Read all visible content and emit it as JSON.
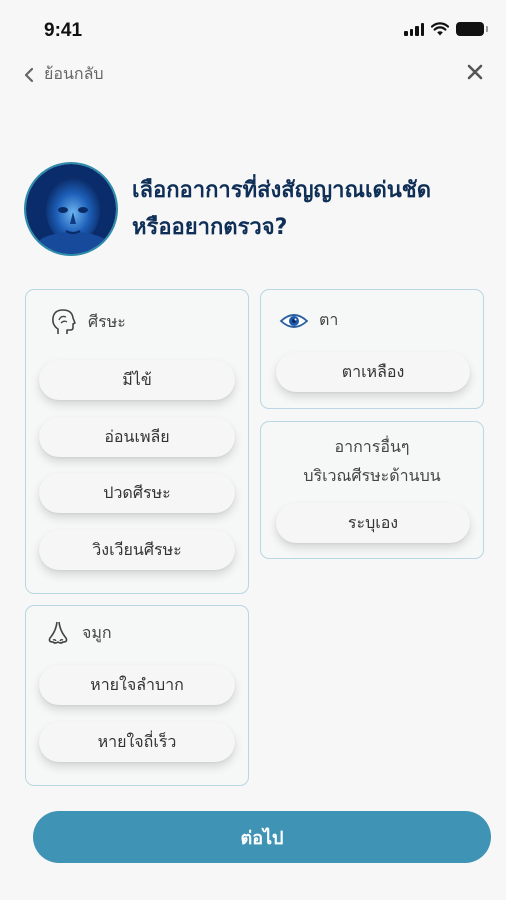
{
  "status_bar": {
    "time": "9:41"
  },
  "nav": {
    "back_label": "ย้อนกลับ"
  },
  "question": {
    "line1": "เลือกอาการที่ส่งสัญญาณเด่นชัด",
    "line2": "หรืออยากตรวจ?"
  },
  "cards": {
    "head": {
      "title": "ศีรษะ",
      "icon": "head-icon",
      "options": [
        "มีไข้",
        "อ่อนเพลีย",
        "ปวดศีรษะ",
        "วิงเวียนศีรษะ"
      ]
    },
    "eye": {
      "title": "ตา",
      "icon": "eye-icon",
      "options": [
        "ตาเหลือง"
      ]
    },
    "other": {
      "title_line1": "อาการอื่นๆ",
      "title_line2": "บริเวณศีรษะด้านบน",
      "options": [
        "ระบุเอง"
      ]
    },
    "nose": {
      "title": "จมูก",
      "icon": "nose-icon",
      "options": [
        "หายใจลำบาก",
        "หายใจถี่เร็ว"
      ]
    }
  },
  "next_button": {
    "label": "ต่อไป"
  },
  "colors": {
    "accent": "#3f93b5",
    "heading": "#0f2f57",
    "card_border": "#b9d7e2"
  }
}
